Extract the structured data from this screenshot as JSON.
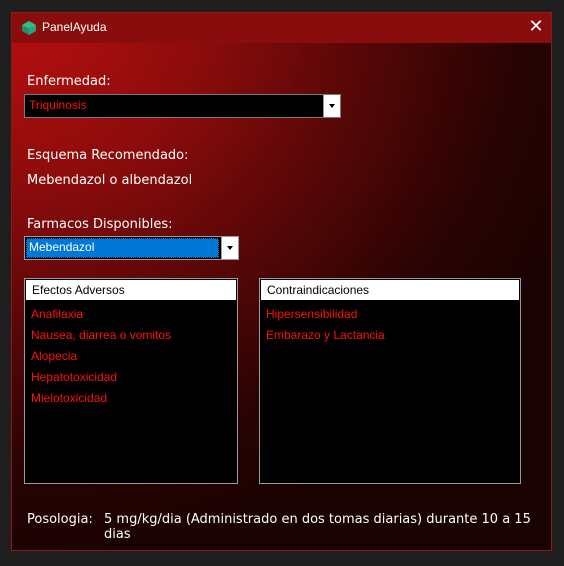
{
  "window": {
    "title": "PanelAyuda",
    "close_icon": "close-icon",
    "app_icon": "app-logo-icon"
  },
  "enfermedad": {
    "label": "Enfermedad:",
    "selected": "Triquinosis"
  },
  "esquema": {
    "label": "Esquema Recomendado:",
    "value": "Mebendazol o albendazol"
  },
  "farmacos": {
    "label": "Farmacos Disponibles:",
    "selected": "Mebendazol"
  },
  "efectos": {
    "header": "Efectos Adversos",
    "items": [
      "Anafilaxia",
      "Nausea, diarrea o vomitos",
      "Alopecia",
      "Hepatotoxicidad",
      "Mielotoxicidad"
    ]
  },
  "contra": {
    "header": "Contraindicaciones",
    "items": [
      "Hipersensibilidad",
      "Embarazo y Lactancia"
    ]
  },
  "posologia": {
    "label": "Posologia:",
    "value": "5 mg/kg/dia (Administrado en dos tomas diarias) durante 10 a 15 dias"
  },
  "colors": {
    "accent_red": "#ff1010",
    "selection_blue": "#0078d7",
    "titlebar": "#8a0d0d"
  }
}
